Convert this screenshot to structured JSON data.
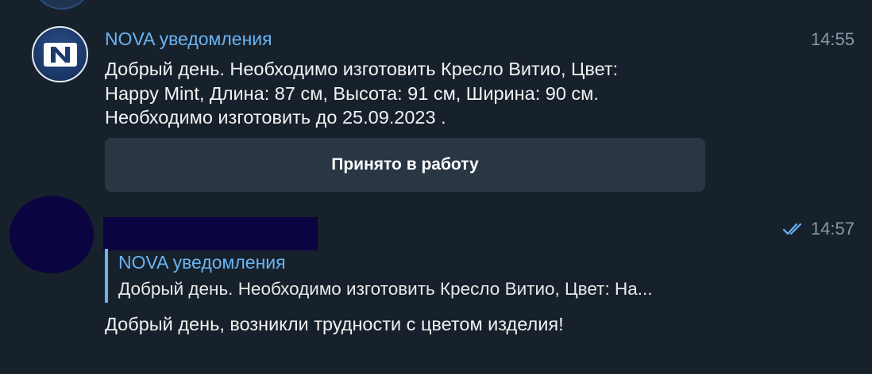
{
  "message_1": {
    "sender": "NOVA уведомления",
    "time": "14:55",
    "avatar_letter": "N",
    "text": "Добрый день. Необходимо изготовить Кресло Витио, Цвет:\nHappy Mint,  Длина: 87 см, Высота: 91 см, Ширина: 90 см.\nНеобходимо изготовить до 25.09.2023 .",
    "button_label": "Принято в работу"
  },
  "message_2": {
    "time": "14:57",
    "status": "read",
    "reply": {
      "sender": "NOVA уведомления",
      "preview": "Добрый день. Необходимо изготовить Кресло Витио, Цвет: На..."
    },
    "text": "Добрый день, возникли трудности с цветом изделия!"
  },
  "colors": {
    "background": "#17212b",
    "accent": "#6ab3f3",
    "button_bg": "#2a3644",
    "redaction": "#0a0440"
  }
}
